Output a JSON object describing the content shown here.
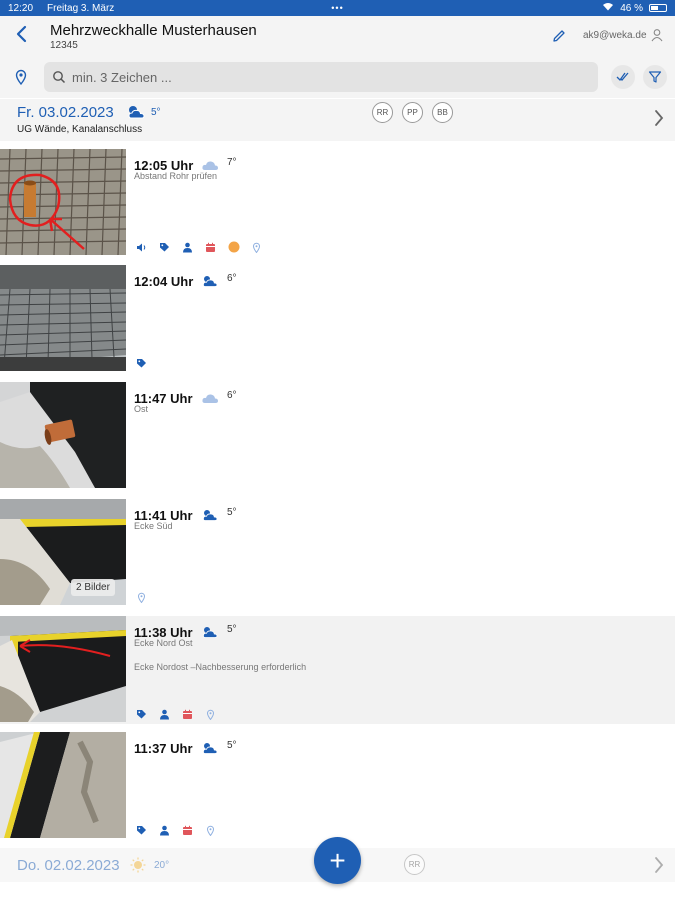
{
  "status": {
    "time": "12:20",
    "date": "Freitag 3. März",
    "dots": "•••",
    "battery": "46 %"
  },
  "header": {
    "title": "Mehrzweckhalle Musterhausen",
    "subtitle": "12345",
    "user": "ak9@weka.de"
  },
  "search": {
    "placeholder": "min. 3 Zeichen ..."
  },
  "day1": {
    "date": "Fr. 03.02.2023",
    "temp": "5°",
    "desc": "UG Wände, Kanalanschluss",
    "initials": [
      "RR",
      "PP",
      "BB"
    ]
  },
  "entries": [
    {
      "time": "12:05 Uhr",
      "temp": "7°",
      "note1": "Abstand Rohr prüfen",
      "note2": ""
    },
    {
      "time": "12:04 Uhr",
      "temp": "6°",
      "note1": "",
      "note2": ""
    },
    {
      "time": "11:47 Uhr",
      "temp": "6°",
      "note1": "Ost",
      "note2": ""
    },
    {
      "time": "11:41 Uhr",
      "temp": "5°",
      "note1": "Ecke Süd",
      "note2": "",
      "badge": "2 Bilder"
    },
    {
      "time": "11:38 Uhr",
      "temp": "5°",
      "note1": "Ecke Nord Ost",
      "note2": "Ecke Nordost –Nachbesserung erforderlich"
    },
    {
      "time": "11:37 Uhr",
      "temp": "5°",
      "note1": "",
      "note2": ""
    }
  ],
  "day2": {
    "date": "Do. 02.02.2023",
    "temp": "20°",
    "initials": [
      "RR"
    ]
  },
  "fab": {
    "label": "+"
  },
  "colors": {
    "accent": "#1f5fb4",
    "tag": "#1f5fb4",
    "calendar": "#e0565b",
    "weather_sun": "#f3a447"
  }
}
